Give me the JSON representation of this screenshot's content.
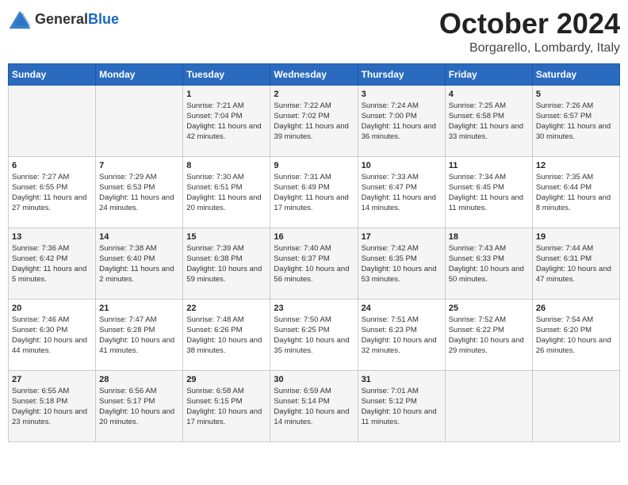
{
  "header": {
    "logo_general": "General",
    "logo_blue": "Blue",
    "month": "October 2024",
    "location": "Borgarello, Lombardy, Italy"
  },
  "weekdays": [
    "Sunday",
    "Monday",
    "Tuesday",
    "Wednesday",
    "Thursday",
    "Friday",
    "Saturday"
  ],
  "weeks": [
    [
      {
        "day": "",
        "info": ""
      },
      {
        "day": "",
        "info": ""
      },
      {
        "day": "1",
        "info": "Sunrise: 7:21 AM\nSunset: 7:04 PM\nDaylight: 11 hours and 42 minutes."
      },
      {
        "day": "2",
        "info": "Sunrise: 7:22 AM\nSunset: 7:02 PM\nDaylight: 11 hours and 39 minutes."
      },
      {
        "day": "3",
        "info": "Sunrise: 7:24 AM\nSunset: 7:00 PM\nDaylight: 11 hours and 36 minutes."
      },
      {
        "day": "4",
        "info": "Sunrise: 7:25 AM\nSunset: 6:58 PM\nDaylight: 11 hours and 33 minutes."
      },
      {
        "day": "5",
        "info": "Sunrise: 7:26 AM\nSunset: 6:57 PM\nDaylight: 11 hours and 30 minutes."
      }
    ],
    [
      {
        "day": "6",
        "info": "Sunrise: 7:27 AM\nSunset: 6:55 PM\nDaylight: 11 hours and 27 minutes."
      },
      {
        "day": "7",
        "info": "Sunrise: 7:29 AM\nSunset: 6:53 PM\nDaylight: 11 hours and 24 minutes."
      },
      {
        "day": "8",
        "info": "Sunrise: 7:30 AM\nSunset: 6:51 PM\nDaylight: 11 hours and 20 minutes."
      },
      {
        "day": "9",
        "info": "Sunrise: 7:31 AM\nSunset: 6:49 PM\nDaylight: 11 hours and 17 minutes."
      },
      {
        "day": "10",
        "info": "Sunrise: 7:33 AM\nSunset: 6:47 PM\nDaylight: 11 hours and 14 minutes."
      },
      {
        "day": "11",
        "info": "Sunrise: 7:34 AM\nSunset: 6:45 PM\nDaylight: 11 hours and 11 minutes."
      },
      {
        "day": "12",
        "info": "Sunrise: 7:35 AM\nSunset: 6:44 PM\nDaylight: 11 hours and 8 minutes."
      }
    ],
    [
      {
        "day": "13",
        "info": "Sunrise: 7:36 AM\nSunset: 6:42 PM\nDaylight: 11 hours and 5 minutes."
      },
      {
        "day": "14",
        "info": "Sunrise: 7:38 AM\nSunset: 6:40 PM\nDaylight: 11 hours and 2 minutes."
      },
      {
        "day": "15",
        "info": "Sunrise: 7:39 AM\nSunset: 6:38 PM\nDaylight: 10 hours and 59 minutes."
      },
      {
        "day": "16",
        "info": "Sunrise: 7:40 AM\nSunset: 6:37 PM\nDaylight: 10 hours and 56 minutes."
      },
      {
        "day": "17",
        "info": "Sunrise: 7:42 AM\nSunset: 6:35 PM\nDaylight: 10 hours and 53 minutes."
      },
      {
        "day": "18",
        "info": "Sunrise: 7:43 AM\nSunset: 6:33 PM\nDaylight: 10 hours and 50 minutes."
      },
      {
        "day": "19",
        "info": "Sunrise: 7:44 AM\nSunset: 6:31 PM\nDaylight: 10 hours and 47 minutes."
      }
    ],
    [
      {
        "day": "20",
        "info": "Sunrise: 7:46 AM\nSunset: 6:30 PM\nDaylight: 10 hours and 44 minutes."
      },
      {
        "day": "21",
        "info": "Sunrise: 7:47 AM\nSunset: 6:28 PM\nDaylight: 10 hours and 41 minutes."
      },
      {
        "day": "22",
        "info": "Sunrise: 7:48 AM\nSunset: 6:26 PM\nDaylight: 10 hours and 38 minutes."
      },
      {
        "day": "23",
        "info": "Sunrise: 7:50 AM\nSunset: 6:25 PM\nDaylight: 10 hours and 35 minutes."
      },
      {
        "day": "24",
        "info": "Sunrise: 7:51 AM\nSunset: 6:23 PM\nDaylight: 10 hours and 32 minutes."
      },
      {
        "day": "25",
        "info": "Sunrise: 7:52 AM\nSunset: 6:22 PM\nDaylight: 10 hours and 29 minutes."
      },
      {
        "day": "26",
        "info": "Sunrise: 7:54 AM\nSunset: 6:20 PM\nDaylight: 10 hours and 26 minutes."
      }
    ],
    [
      {
        "day": "27",
        "info": "Sunrise: 6:55 AM\nSunset: 5:18 PM\nDaylight: 10 hours and 23 minutes."
      },
      {
        "day": "28",
        "info": "Sunrise: 6:56 AM\nSunset: 5:17 PM\nDaylight: 10 hours and 20 minutes."
      },
      {
        "day": "29",
        "info": "Sunrise: 6:58 AM\nSunset: 5:15 PM\nDaylight: 10 hours and 17 minutes."
      },
      {
        "day": "30",
        "info": "Sunrise: 6:59 AM\nSunset: 5:14 PM\nDaylight: 10 hours and 14 minutes."
      },
      {
        "day": "31",
        "info": "Sunrise: 7:01 AM\nSunset: 5:12 PM\nDaylight: 10 hours and 11 minutes."
      },
      {
        "day": "",
        "info": ""
      },
      {
        "day": "",
        "info": ""
      }
    ]
  ]
}
